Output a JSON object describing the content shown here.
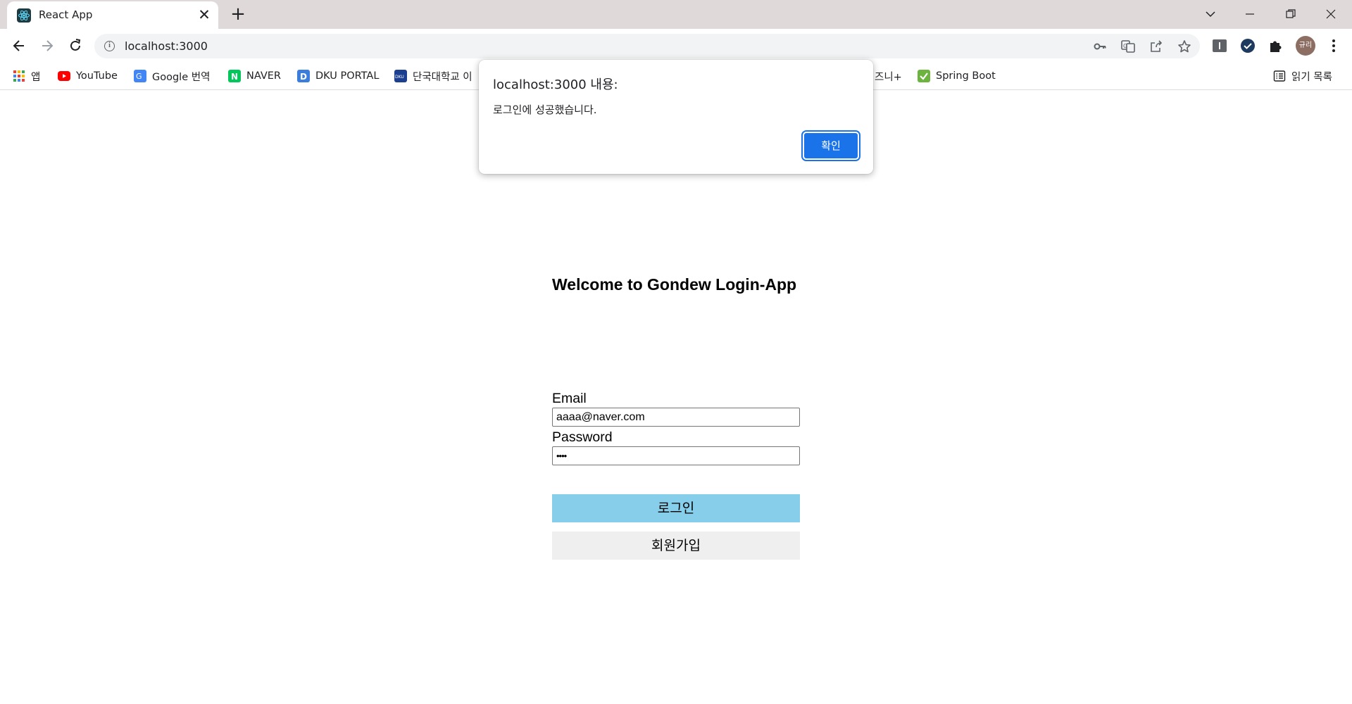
{
  "browser": {
    "tab": {
      "title": "React App"
    },
    "address_bar": {
      "url": "localhost:3000"
    },
    "profile_initials": "규리",
    "bookmarks": [
      {
        "label": "앱",
        "icon": "apps-grid-icon"
      },
      {
        "label": "YouTube",
        "icon": "youtube-icon",
        "color": "#ff0000"
      },
      {
        "label": "Google 번역",
        "icon": "google-translate-icon",
        "color": "#4285f4"
      },
      {
        "label": "NAVER",
        "icon": "naver-icon",
        "color": "#03c75a"
      },
      {
        "label": "DKU PORTAL",
        "icon": "dku-portal-icon",
        "color": "#3b7ddd"
      },
      {
        "label": "단국대학교 이",
        "icon": "dku-icon",
        "color": "#1d3f8f"
      },
      {
        "label": "즈니+",
        "icon": "bookmark-icon"
      },
      {
        "label": "Spring Boot",
        "icon": "checkmark-icon",
        "color": "#6db33f"
      }
    ],
    "reading_list": "읽기 목록"
  },
  "page": {
    "title": "Welcome to Gondew Login-App",
    "email_label": "Email",
    "email_value": "aaaa@naver.com",
    "password_label": "Password",
    "password_value": "••••",
    "login_button": "로그인",
    "signup_button": "회원가입",
    "colors": {
      "login_button": "#87ceeb",
      "signup_button": "#efefef"
    }
  },
  "dialog": {
    "title": "localhost:3000 내용:",
    "message": "로그인에 성공했습니다.",
    "ok_button": "확인",
    "ok_color": "#1a73e8"
  }
}
